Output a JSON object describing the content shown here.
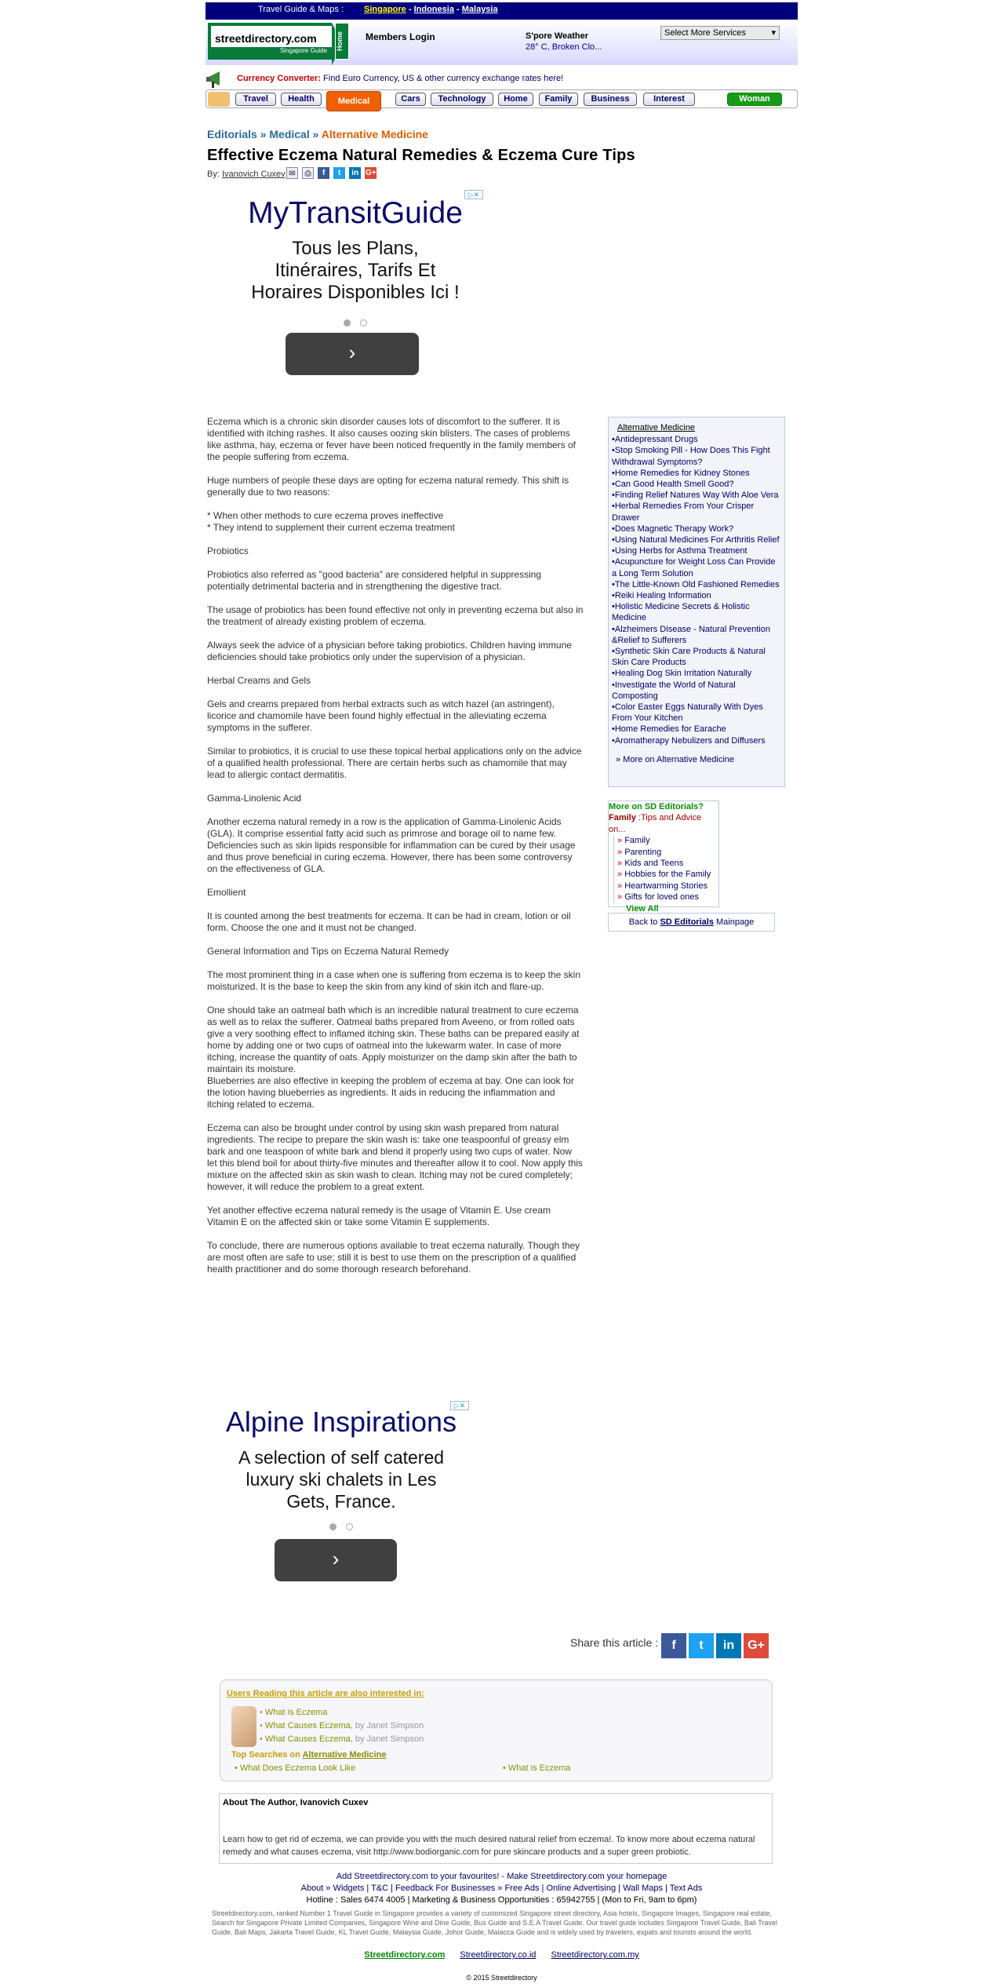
{
  "topbar": {
    "label": "Travel Guide & Maps :",
    "links": [
      "Singapore",
      "Indonesia",
      "Malaysia"
    ],
    "sep": "-"
  },
  "header": {
    "logo_text": "streetdirectory.com",
    "logo_sub": "Singapore Guide",
    "home_tab": "Home",
    "members_login": "Members Login",
    "weather_title": "S'pore Weather",
    "weather_value": "28° C, Broken Clo...",
    "services_select": "Select More Services"
  },
  "currency": {
    "label": "Currency Converter:",
    "text": "Find Euro Currency, US & other currency exchange rates here!"
  },
  "nav": {
    "tabs": [
      "Travel",
      "Health",
      "Medical",
      "Cars",
      "Technology",
      "Home",
      "Family",
      "Business",
      "Interest",
      "Woman"
    ]
  },
  "breadcrumb": {
    "items": [
      "Editorials",
      "Medical",
      "Alternative Medicine"
    ],
    "sep": "»"
  },
  "article": {
    "title": "Effective Eczema Natural Remedies & Eczema Cure Tips",
    "by_label": "By:",
    "author": "Ivanovich Cuxev",
    "paragraphs": [
      "Eczema which is a chronic skin disorder causes lots of discomfort to the sufferer. It is identified with itching rashes. It also causes oozing skin blisters. The cases of problems like asthma, hay, eczema or fever have been noticed frequently in the family members of the people suffering from eczema.",
      "Huge numbers of people these days are opting for eczema natural remedy. This shift is generally due to two reasons:",
      "* When other methods to cure eczema proves ineffective\n* They intend to supplement their current eczema treatment",
      "Probiotics",
      "Probiotics also referred as \"good bacteria\" are considered helpful in suppressing potentially detrimental bacteria and in strengthening the digestive tract.",
      "The usage of probiotics has been found effective not only in preventing eczema but also in the treatment of already existing problem of eczema.",
      "Always seek the advice of a physician before taking probiotics. Children having immune deficiencies should take probiotics only under the supervision of a physician.",
      "Herbal Creams and Gels",
      "Gels and creams prepared from herbal extracts such as witch hazel (an astringent), licorice and chamomile have been found highly effectual in the alleviating eczema symptoms in the sufferer.",
      "Similar to probiotics, it is crucial to use these topical herbal applications only on the advice of a qualified health professional. There are certain herbs such as chamomile that may lead to allergic contact dermatitis.",
      "Gamma-Linolenic Acid",
      "Another eczema natural remedy in a row is the application of Gamma-Linolenic Acids (GLA). It comprise essential fatty acid such as primrose and borage oil to name few. Deficiencies such as skin lipids responsible for inflammation can be cured by their usage and thus prove beneficial in curing eczema. However, there has been some controversy on the effectiveness of GLA.",
      "Emollient",
      "It is counted among the best treatments for eczema. It can be had in cream, lotion or oil form. Choose the one and it must not be changed.",
      "General Information and Tips on Eczema Natural Remedy",
      "The most prominent thing in a case when one is suffering from eczema is to keep the skin moisturized. It is the base to keep the skin from any kind of skin itch and flare-up.",
      "One should take an oatmeal bath which is an incredible natural treatment to cure eczema as well as to relax the sufferer. Oatmeal baths prepared from Aveeno, or from rolled oats give a very soothing effect to inflamed itching skin. These baths can be prepared easily at home by adding one or two cups of oatmeal into the lukewarm water. In case of more itching, increase the quantity of oats. Apply moisturizer on the damp skin after the bath to maintain its moisture.\nBlueberries are also effective in keeping the problem of eczema at bay. One can look for the lotion having blueberries as ingredients. It aids in reducing the inflammation and itching related to eczema.",
      "Eczema can also be brought under control by using skin wash prepared from natural ingredients. The recipe to prepare the skin wash is: take one teaspoonful of greasy elm bark and one teaspoon of white bark and blend it properly using two cups of water. Now let this blend boil for about thirty-five minutes and thereafter allow it to cool. Now apply this mixture on the affected skin as skin wash to clean. Itching may not be cured completely; however, it will reduce the problem to a great extent.",
      "Yet another effective eczema natural remedy is the usage of Vitamin E. Use cream Vitamin E on the affected skin or take some Vitamin E supplements.",
      "To conclude, there are numerous options available to treat eczema naturally. Though they are most often are safe to use; still it is best to use them on the prescription of a qualified health practitioner and do some thorough research beforehand."
    ]
  },
  "ad1": {
    "headline": "MyTransitGuide",
    "body": "Tous les Plans, Itinéraires, Tarifs Et Horaires Disponibles Ici !",
    "button": "›"
  },
  "ad2": {
    "headline": "Alpine Inspirations",
    "body": "A selection of self catered luxury ski chalets in Les Gets, France.",
    "button": "›"
  },
  "sidebar": {
    "heading": "Alternative Medicine",
    "links": [
      "•Antidepressant Drugs",
      "•Stop Smoking Pill - How Does This Fight Withdrawal Symptoms?",
      "•Home Remedies for Kidney Stones",
      "•Can Good Health Smell Good?",
      "•Finding Relief Natures Way With Aloe Vera",
      "•Herbal Remedies From Your Crisper Drawer",
      "•Does Magnetic Therapy Work?",
      "•Using Natural Medicines For Arthritis Relief",
      "•Using Herbs for Asthma Treatment",
      "•Acupuncture for Weight Loss Can Provide a Long Term Solution",
      "•The Little-Known Old Fashioned Remedies",
      "•Reiki Healing Information",
      "•Holistic Medicine Secrets & Holistic Medicine",
      "•Alzheimers Disease - Natural Prevention &Relief to Sufferers",
      "•Synthetic Skin Care Products & Natural Skin Care Products",
      "•Healing Dog Skin Irritation Naturally",
      "•Investigate the World of Natural Composting",
      "•Color Easter Eggs Naturally With Dyes From Your Kitchen",
      "•Home Remedies for Earache",
      "•Aromatherapy Nebulizers and Diffusers"
    ],
    "more": "» More on Alternative Medicine"
  },
  "editorials": {
    "heading": "More on SD Editorials?",
    "sub_bold": "Family",
    "sub_rest": " :Tips and Advice on...",
    "items": [
      "Family",
      "Parenting",
      "Kids and Teens",
      "Hobbies for the Family",
      "Heartwarming Stories",
      "Gifts for loved ones"
    ],
    "view_all": "View All"
  },
  "back": {
    "pre": "Back to ",
    "link": "SD Editorials",
    "post": " Mainpage"
  },
  "share": {
    "label": "Share this article :",
    "buttons": [
      "f",
      "t",
      "in",
      "G+"
    ]
  },
  "also": {
    "heading": "Users Reading this article are also interested in:",
    "items": [
      {
        "t": "What is Eczema",
        "by": ""
      },
      {
        "t": "What Causes Eczema,",
        "by": " by Janet Simpson"
      },
      {
        "t": "What Causes Eczema,",
        "by": " by Janet Simpson"
      }
    ],
    "top_label": "Top Searches on ",
    "top_link": "Alternative Medicine",
    "s1": "• What Does Eczema Look Like",
    "s2": "• What is Eczema"
  },
  "author_box": {
    "heading_pre": "About The Author, ",
    "heading_name": "Ivanovich Cuxev",
    "body": "Learn how to get rid of eczema, we can provide you with the much desired natural relief from eczema!. To know more about eczema natural remedy and what causes eczema, visit http://www.bodiorganic.com for pure skincare products and a super green probiotic."
  },
  "footer": {
    "line1": "Add Streetdirectory.com to your favourites! - Make Streetdirectory.com your homepage",
    "line2": "About » Widgets | T&C | Feedback  For Businesses » Free Ads | Online Advertising | Wall Maps | Text Ads",
    "line3": "Hotline : Sales 6474 4005 | Marketing & Business Opportunities : 65942755 | (Mon to Fri, 9am to 6pm)",
    "small": "Streetdirectory.com, ranked Number 1 Travel Guide in Singapore provides a variety of customized Singapore street directory, Asia hotels, Singapore Images, Singapore real estate, Search for Singapore Private Limited Companies, Singapore Wine and Dine Guide, Bus Guide and S.E.A Travel Guide. Our travel guide includes Singapore Travel Guide, Bali Travel Guide, Bali Maps, Jakarta Travel Guide, KL Travel Guide, Malaysia Guide, Johor Guide, Malacca Guide and is widely used by travelers, expats and tourists around the world.",
    "sites": [
      "Streetdirectory.com",
      "Streetdirectory.co.id",
      "Streetdirectory.com.my"
    ],
    "copyright": "© 2015 Streetdirectory"
  }
}
